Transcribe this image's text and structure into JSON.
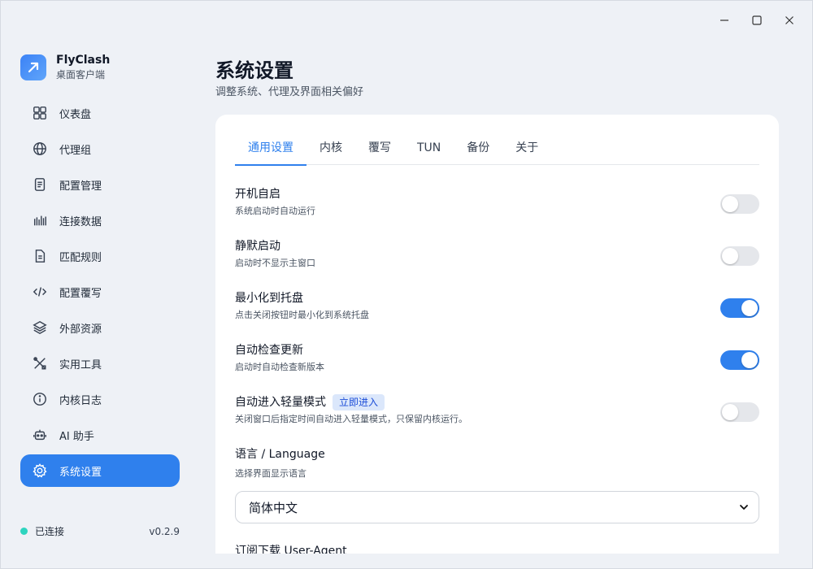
{
  "app": {
    "name": "FlyClash",
    "subtitle": "桌面客户端"
  },
  "window_controls": {
    "minimize_icon": "minimize-icon",
    "maximize_icon": "maximize-icon",
    "close_icon": "close-icon"
  },
  "sidebar": {
    "items": [
      {
        "label": "仪表盘",
        "icon": "dashboard-grid-icon"
      },
      {
        "label": "代理组",
        "icon": "globe-icon"
      },
      {
        "label": "配置管理",
        "icon": "document-icon"
      },
      {
        "label": "连接数据",
        "icon": "bars-icon"
      },
      {
        "label": "匹配规则",
        "icon": "file-lines-icon"
      },
      {
        "label": "配置覆写",
        "icon": "code-icon"
      },
      {
        "label": "外部资源",
        "icon": "layers-icon"
      },
      {
        "label": "实用工具",
        "icon": "tools-icon"
      },
      {
        "label": "内核日志",
        "icon": "info-icon"
      },
      {
        "label": "AI 助手",
        "icon": "robot-icon"
      },
      {
        "label": "系统设置",
        "icon": "gear-icon",
        "active": true
      }
    ],
    "status": {
      "label": "已连接",
      "color": "#2dd4bf"
    },
    "version": "v0.2.9"
  },
  "page": {
    "title": "系统设置",
    "subtitle": "调整系统、代理及界面相关偏好"
  },
  "tabs": [
    "通用设置",
    "内核",
    "覆写",
    "TUN",
    "备份",
    "关于"
  ],
  "active_tab": "通用设置",
  "settings": [
    {
      "title": "开机自启",
      "desc": "系统启动时自动运行",
      "enabled": false
    },
    {
      "title": "静默启动",
      "desc": "启动时不显示主窗口",
      "enabled": false
    },
    {
      "title": "最小化到托盘",
      "desc": "点击关闭按钮时最小化到系统托盘",
      "enabled": true
    },
    {
      "title": "自动检查更新",
      "desc": "启动时自动检查新版本",
      "enabled": true
    },
    {
      "title": "自动进入轻量模式",
      "badge": "立即进入",
      "desc": "关闭窗口后指定时间自动进入轻量模式，只保留内核运行。",
      "enabled": false
    }
  ],
  "language": {
    "title": "语言 / Language",
    "desc": "选择界面显示语言",
    "selected": "简体中文"
  },
  "next_section_title": "订阅下载 User-Agent",
  "colors": {
    "accent": "#2f80ed",
    "background": "#eef1f6",
    "card": "#ffffff"
  }
}
